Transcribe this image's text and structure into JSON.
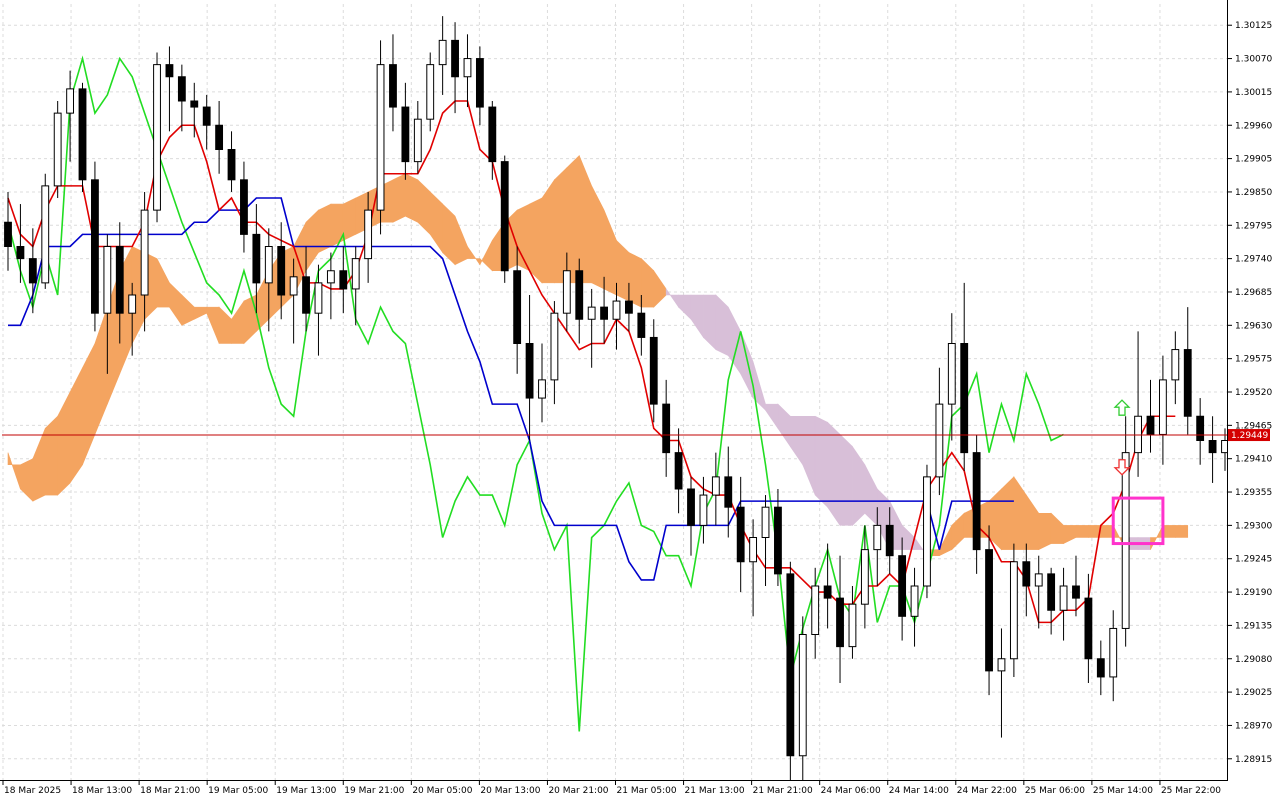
{
  "chart_data": {
    "type": "candlestick",
    "ylim": [
      1.2888,
      1.3016
    ],
    "y_ticks": [
      "1.30125",
      "1.30070",
      "1.30015",
      "1.29960",
      "1.29905",
      "1.29850",
      "1.29795",
      "1.29740",
      "1.29685",
      "1.29630",
      "1.29575",
      "1.29520",
      "1.29465",
      "1.29410",
      "1.29355",
      "1.29300",
      "1.29245",
      "1.29190",
      "1.29135",
      "1.29080",
      "1.29025",
      "1.28970",
      "1.28915"
    ],
    "x_ticks": [
      "18 Mar 2025",
      "18 Mar 13:00",
      "18 Mar 21:00",
      "19 Mar 05:00",
      "19 Mar 13:00",
      "19 Mar 21:00",
      "20 Mar 05:00",
      "20 Mar 13:00",
      "20 Mar 21:00",
      "21 Mar 05:00",
      "21 Mar 13:00",
      "21 Mar 21:00",
      "24 Mar 06:00",
      "24 Mar 14:00",
      "24 Mar 22:00",
      "25 Mar 06:00",
      "25 Mar 14:00",
      "25 Mar 22:00"
    ],
    "current_price": "1.29449",
    "grid": true,
    "colors": {
      "bull_cloud": "#f4a460",
      "bear_cloud": "#d8bfd8",
      "tenkan": "#e00000",
      "kijun": "#0000cc",
      "chikou": "#22dd22",
      "price_line": "#c00000",
      "candle": "#000000",
      "highlight_box": "#ff33cc",
      "arrow_up": "#33cc33",
      "arrow_down": "#ee3333"
    },
    "candles": [
      [
        1.298,
        1.2985,
        1.2972,
        1.2976
      ],
      [
        1.2976,
        1.2983,
        1.297,
        1.2974
      ],
      [
        1.2974,
        1.2979,
        1.2965,
        1.297
      ],
      [
        1.297,
        1.2988,
        1.2969,
        1.2986
      ],
      [
        1.2986,
        1.3,
        1.2984,
        1.2998
      ],
      [
        1.2998,
        1.3005,
        1.299,
        1.3002
      ],
      [
        1.3002,
        1.3003,
        1.2985,
        1.2987
      ],
      [
        1.2987,
        1.299,
        1.2962,
        1.2965
      ],
      [
        1.2965,
        1.2978,
        1.2955,
        1.2976
      ],
      [
        1.2976,
        1.298,
        1.296,
        1.2965
      ],
      [
        1.2965,
        1.297,
        1.2958,
        1.2968
      ],
      [
        1.2968,
        1.2985,
        1.2962,
        1.2982
      ],
      [
        1.2982,
        1.3008,
        1.298,
        1.3006
      ],
      [
        1.3006,
        1.3009,
        1.2995,
        1.3004
      ],
      [
        1.3004,
        1.3006,
        1.2995,
        1.3
      ],
      [
        1.3,
        1.3003,
        1.2994,
        1.2999
      ],
      [
        1.2999,
        1.3001,
        1.2992,
        1.2996
      ],
      [
        1.2996,
        1.3,
        1.2988,
        1.2992
      ],
      [
        1.2992,
        1.2995,
        1.2985,
        1.2987
      ],
      [
        1.2987,
        1.299,
        1.2975,
        1.2978
      ],
      [
        1.2978,
        1.2983,
        1.2965,
        1.297
      ],
      [
        1.297,
        1.2979,
        1.2962,
        1.2976
      ],
      [
        1.2976,
        1.298,
        1.2964,
        1.2968
      ],
      [
        1.2968,
        1.2974,
        1.296,
        1.2971
      ],
      [
        1.2971,
        1.2976,
        1.2962,
        1.2965
      ],
      [
        1.2965,
        1.2973,
        1.2958,
        1.297
      ],
      [
        1.297,
        1.2975,
        1.2964,
        1.2972
      ],
      [
        1.2972,
        1.2976,
        1.2965,
        1.2969
      ],
      [
        1.2969,
        1.2976,
        1.2963,
        1.2974
      ],
      [
        1.2974,
        1.2985,
        1.297,
        1.2982
      ],
      [
        1.2982,
        1.301,
        1.2978,
        1.3006
      ],
      [
        1.3006,
        1.3011,
        1.2995,
        1.2999
      ],
      [
        1.2999,
        1.3003,
        1.2987,
        1.299
      ],
      [
        1.299,
        1.3,
        1.2988,
        1.2997
      ],
      [
        1.2997,
        1.3008,
        1.2995,
        1.3006
      ],
      [
        1.3006,
        1.3014,
        1.3001,
        1.301
      ],
      [
        1.301,
        1.3013,
        1.2998,
        1.3004
      ],
      [
        1.3004,
        1.3011,
        1.2999,
        1.3007
      ],
      [
        1.3007,
        1.3009,
        1.2996,
        1.2999
      ],
      [
        1.2999,
        1.3,
        1.2987,
        1.299
      ],
      [
        1.299,
        1.2991,
        1.297,
        1.2972
      ],
      [
        1.2972,
        1.2976,
        1.2955,
        1.296
      ],
      [
        1.296,
        1.2968,
        1.2944,
        1.2951
      ],
      [
        1.2951,
        1.296,
        1.2947,
        1.2954
      ],
      [
        1.2954,
        1.2967,
        1.295,
        1.2965
      ],
      [
        1.2965,
        1.2975,
        1.2962,
        1.2972
      ],
      [
        1.2972,
        1.2974,
        1.296,
        1.2964
      ],
      [
        1.2964,
        1.2969,
        1.2956,
        1.2966
      ],
      [
        1.2966,
        1.2971,
        1.296,
        1.2964
      ],
      [
        1.2964,
        1.297,
        1.2959,
        1.2967
      ],
      [
        1.2967,
        1.297,
        1.2962,
        1.2965
      ],
      [
        1.2965,
        1.2968,
        1.2958,
        1.2961
      ],
      [
        1.2961,
        1.2964,
        1.2947,
        1.295
      ],
      [
        1.295,
        1.2954,
        1.2938,
        1.2942
      ],
      [
        1.2942,
        1.2946,
        1.2932,
        1.2936
      ],
      [
        1.2936,
        1.2938,
        1.2925,
        1.293
      ],
      [
        1.293,
        1.2938,
        1.2927,
        1.2935
      ],
      [
        1.2935,
        1.2942,
        1.293,
        1.2938
      ],
      [
        1.2938,
        1.2943,
        1.2928,
        1.2933
      ],
      [
        1.2933,
        1.2938,
        1.2919,
        1.2924
      ],
      [
        1.2924,
        1.2931,
        1.2915,
        1.2928
      ],
      [
        1.2928,
        1.2935,
        1.292,
        1.2933
      ],
      [
        1.2933,
        1.2936,
        1.292,
        1.2922
      ],
      [
        1.2922,
        1.2924,
        1.2886,
        1.2892
      ],
      [
        1.2892,
        1.2915,
        1.2888,
        1.2912
      ],
      [
        1.2912,
        1.2923,
        1.2908,
        1.292
      ],
      [
        1.292,
        1.2927,
        1.2913,
        1.2918
      ],
      [
        1.2918,
        1.2925,
        1.2904,
        1.291
      ],
      [
        1.291,
        1.292,
        1.2908,
        1.2917
      ],
      [
        1.2917,
        1.293,
        1.2913,
        1.2926
      ],
      [
        1.2926,
        1.2933,
        1.292,
        1.293
      ],
      [
        1.293,
        1.2933,
        1.2922,
        1.2925
      ],
      [
        1.2925,
        1.2928,
        1.2911,
        1.2915
      ],
      [
        1.2915,
        1.2923,
        1.291,
        1.292
      ],
      [
        1.292,
        1.294,
        1.2918,
        1.2938
      ],
      [
        1.2938,
        1.2956,
        1.2935,
        1.295
      ],
      [
        1.295,
        1.2965,
        1.2944,
        1.296
      ],
      [
        1.296,
        1.297,
        1.2939,
        1.2942
      ],
      [
        1.2942,
        1.2945,
        1.2922,
        1.2926
      ],
      [
        1.2926,
        1.293,
        1.2902,
        1.2906
      ],
      [
        1.2906,
        1.2913,
        1.2895,
        1.2908
      ],
      [
        1.2908,
        1.2927,
        1.2905,
        1.2924
      ],
      [
        1.2924,
        1.2927,
        1.2915,
        1.292
      ],
      [
        1.292,
        1.2925,
        1.2913,
        1.2922
      ],
      [
        1.2922,
        1.2923,
        1.2912,
        1.2916
      ],
      [
        1.2916,
        1.2923,
        1.2911,
        1.292
      ],
      [
        1.292,
        1.2925,
        1.2915,
        1.2918
      ],
      [
        1.2918,
        1.2922,
        1.2904,
        1.2908
      ],
      [
        1.2908,
        1.2911,
        1.2902,
        1.2905
      ],
      [
        1.2905,
        1.2916,
        1.2901,
        1.2913
      ],
      [
        1.2913,
        1.2948,
        1.291,
        1.2942
      ],
      [
        1.2942,
        1.2962,
        1.2938,
        1.2948
      ],
      [
        1.2948,
        1.2954,
        1.2942,
        1.2945
      ],
      [
        1.2945,
        1.2958,
        1.294,
        1.2954
      ],
      [
        1.2954,
        1.2962,
        1.295,
        1.2959
      ],
      [
        1.2959,
        1.2966,
        1.2945,
        1.2948
      ],
      [
        1.2948,
        1.2951,
        1.294,
        1.2944
      ],
      [
        1.2944,
        1.2948,
        1.2937,
        1.2942
      ],
      [
        1.2942,
        1.2946,
        1.2939,
        1.2944
      ]
    ],
    "tenkan": [
      1.2984,
      1.2978,
      1.2976,
      1.2982,
      1.2986,
      1.2986,
      1.2986,
      1.2976,
      1.2976,
      1.2976,
      1.2976,
      1.298,
      1.299,
      1.2994,
      1.2996,
      1.2996,
      1.299,
      1.2982,
      1.2984,
      1.298,
      1.298,
      1.2978,
      1.2977,
      1.2976,
      1.297,
      1.297,
      1.2969,
      1.2969,
      1.2972,
      1.2978,
      1.2988,
      1.2988,
      1.2988,
      1.2988,
      1.2992,
      1.2998,
      1.3,
      1.3,
      1.2992,
      1.299,
      1.2982,
      1.2976,
      1.2972,
      1.2968,
      1.2965,
      1.2962,
      1.2959,
      1.296,
      1.296,
      1.2964,
      1.2962,
      1.2956,
      1.2946,
      1.2944,
      1.2944,
      1.2938,
      1.2936,
      1.2935,
      1.2935,
      1.293,
      1.2926,
      1.2923,
      1.2923,
      1.2923,
      1.2921,
      1.2919,
      1.2919,
      1.2917,
      1.2917,
      1.292,
      1.292,
      1.2922,
      1.292,
      1.2928,
      1.2936,
      1.2939,
      1.2942,
      1.2939,
      1.293,
      1.2928,
      1.2924,
      1.2924,
      1.2921,
      1.2914,
      1.2914,
      1.2916,
      1.2916,
      1.2918,
      1.293,
      1.2932,
      1.2937,
      1.2944,
      1.2948,
      1.2948,
      1.2948
    ],
    "kijun": [
      1.2963,
      1.2963,
      1.2968,
      1.2976,
      1.2976,
      1.2976,
      1.2978,
      1.2978,
      1.2978,
      1.2978,
      1.2978,
      1.2978,
      1.2978,
      1.2978,
      1.2978,
      1.298,
      1.298,
      1.2982,
      1.2982,
      1.2982,
      1.2984,
      1.2984,
      1.2984,
      1.2976,
      1.2976,
      1.2976,
      1.2976,
      1.2976,
      1.2976,
      1.2976,
      1.2976,
      1.2976,
      1.2976,
      1.2976,
      1.2976,
      1.2974,
      1.2968,
      1.2962,
      1.2957,
      1.295,
      1.295,
      1.295,
      1.2944,
      1.2934,
      1.293,
      1.293,
      1.293,
      1.293,
      1.293,
      1.293,
      1.2924,
      1.2921,
      1.2921,
      1.293,
      1.293,
      1.293,
      1.293,
      1.293,
      1.293,
      1.2934,
      1.2934,
      1.2934,
      1.2934,
      1.2934,
      1.2934,
      1.2934,
      1.2934,
      1.2934,
      1.2934,
      1.2934,
      1.2934,
      1.2934,
      1.2934,
      1.2934,
      1.2934,
      1.2926,
      1.2934,
      1.2934,
      1.2934,
      1.2934,
      1.2934,
      1.2934
    ],
    "chikou": [
      1.298,
      1.2972,
      1.2966,
      1.2975,
      1.2968,
      1.3,
      1.3007,
      1.2998,
      1.3001,
      1.3007,
      1.3004,
      1.2998,
      1.2992,
      1.2986,
      1.298,
      1.2975,
      1.297,
      1.2968,
      1.2965,
      1.2972,
      1.2965,
      1.2956,
      1.295,
      1.2948,
      1.2962,
      1.2972,
      1.2974,
      1.2978,
      1.2964,
      1.296,
      1.2966,
      1.2962,
      1.296,
      1.295,
      1.294,
      1.2928,
      1.2934,
      1.2938,
      1.2935,
      1.2935,
      1.293,
      1.294,
      1.2944,
      1.2932,
      1.2926,
      1.293,
      1.2896,
      1.2928,
      1.293,
      1.2934,
      1.2937,
      1.293,
      1.2929,
      1.2925,
      1.2925,
      1.292,
      1.2932,
      1.2936,
      1.2954,
      1.2962,
      1.2953,
      1.294,
      1.2925,
      1.2905,
      1.2913,
      1.292,
      1.2926,
      1.2918,
      1.2915,
      1.293,
      1.2914,
      1.292,
      1.292,
      1.2914,
      1.2922,
      1.293,
      1.2948,
      1.295,
      1.2955,
      1.2942,
      1.295,
      1.2944,
      1.2955,
      1.295,
      1.2944,
      1.2945
    ],
    "senkou_a": [
      1.294,
      1.294,
      1.2941,
      1.2946,
      1.2948,
      1.2952,
      1.2956,
      1.296,
      1.2966,
      1.2972,
      1.2976,
      1.2975,
      1.2974,
      1.297,
      1.2968,
      1.2966,
      1.2966,
      1.2966,
      1.2964,
      1.2967,
      1.2968,
      1.2972,
      1.2975,
      1.2976,
      1.298,
      1.2982,
      1.2983,
      1.2983,
      1.2984,
      1.2985,
      1.2986,
      1.2987,
      1.2988,
      1.2987,
      1.2985,
      1.2983,
      1.2981,
      1.2976,
      1.2973,
      1.2977,
      1.298,
      1.2982,
      1.2983,
      1.2984,
      1.2987,
      1.2989,
      1.2991,
      1.2986,
      1.2982,
      1.2977,
      1.2975,
      1.2974,
      1.2972,
      1.2969,
      1.2966,
      1.2964,
      1.2961,
      1.2959,
      1.2958,
      1.2955,
      1.2951,
      1.2949,
      1.2946,
      1.2943,
      1.294,
      1.2935,
      1.2933,
      1.293,
      1.293,
      1.2932,
      1.293,
      1.2926,
      1.2926,
      1.2926,
      1.2926,
      1.2926,
      1.293,
      1.2932,
      1.2933,
      1.2934,
      1.2936,
      1.2938,
      1.2935,
      1.2932,
      1.2932,
      1.293,
      1.293,
      1.293,
      1.293,
      1.293,
      1.2926,
      1.2926,
      1.2926,
      1.293,
      1.293,
      1.293
    ],
    "senkou_b": [
      1.2942,
      1.2936,
      1.2934,
      1.2935,
      1.2935,
      1.2937,
      1.294,
      1.2945,
      1.295,
      1.2955,
      1.296,
      1.2964,
      1.2966,
      1.2966,
      1.2963,
      1.2964,
      1.2965,
      1.296,
      1.296,
      1.296,
      1.2962,
      1.2964,
      1.2966,
      1.2968,
      1.2972,
      1.2975,
      1.2976,
      1.2977,
      1.2978,
      1.2979,
      1.298,
      1.298,
      1.2981,
      1.298,
      1.2978,
      1.2975,
      1.2973,
      1.2974,
      1.2974,
      1.2972,
      1.2972,
      1.2973,
      1.2972,
      1.297,
      1.297,
      1.297,
      1.297,
      1.297,
      1.2969,
      1.2968,
      1.2967,
      1.2966,
      1.2966,
      1.2968,
      1.2968,
      1.2968,
      1.2968,
      1.2968,
      1.2966,
      1.2962,
      1.2957,
      1.295,
      1.295,
      1.2948,
      1.2948,
      1.2948,
      1.2947,
      1.2945,
      1.2943,
      1.294,
      1.2936,
      1.2934,
      1.293,
      1.2928,
      1.2925,
      1.2925,
      1.2926,
      1.2928,
      1.2928,
      1.2928,
      1.2926,
      1.2926,
      1.2926,
      1.2926,
      1.2927,
      1.2927,
      1.2928,
      1.2928,
      1.2928,
      1.2928,
      1.2928,
      1.2928,
      1.2928,
      1.2928,
      1.2928,
      1.2928
    ]
  }
}
